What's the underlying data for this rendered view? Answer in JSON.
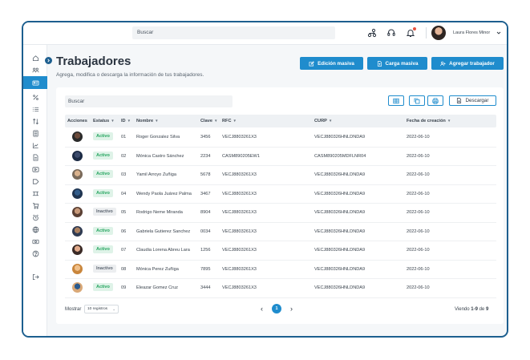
{
  "header": {
    "search_placeholder": "Buscar",
    "user_name": "Laura Flores Minor"
  },
  "page": {
    "title": "Trabajadores",
    "subtitle": "Agrega, modifica o descarga la información de tus trabajadores."
  },
  "actions": {
    "bulk_edit": "Edición masiva",
    "bulk_upload": "Carga masiva",
    "add_worker": "Agregar trabajador",
    "download": "Descargar"
  },
  "table": {
    "search_placeholder": "Buscar",
    "columns": [
      "Acciones",
      "Estatus",
      "ID",
      "Nombre",
      "Clave",
      "RFC",
      "CURP",
      "Fecha de creación"
    ],
    "rows": [
      {
        "status": "Activo",
        "id": "01",
        "name": "Roger Gonzalez Silva",
        "clave": "3456",
        "rfc": "VECJ8803261X3",
        "curp": "VECJ880326HNLDNDA9",
        "date": "2022-06-10"
      },
      {
        "status": "Activo",
        "id": "02",
        "name": "Mónica Castro Sánchez",
        "clave": "2234",
        "rfc": "CASM890205EW1",
        "curp": "CASM890205MDFLNR04",
        "date": "2022-06-10"
      },
      {
        "status": "Activo",
        "id": "03",
        "name": "Yamil Arroyo Zuñiga",
        "clave": "5678",
        "rfc": "VECJ8803261X3",
        "curp": "VECJ880326HNLDNDA9",
        "date": "2022-06-10"
      },
      {
        "status": "Activo",
        "id": "04",
        "name": "Wendy Paola Juárez Palma",
        "clave": "3467",
        "rfc": "VECJ8803261X3",
        "curp": "VECJ880326HNLDNDA9",
        "date": "2022-06-10"
      },
      {
        "status": "Inactivo",
        "id": "05",
        "name": "Rodrigo Neme Miranda",
        "clave": "8904",
        "rfc": "VECJ8803261X3",
        "curp": "VECJ880326HNLDNDA9",
        "date": "2022-06-10"
      },
      {
        "status": "Activo",
        "id": "06",
        "name": "Gabriela Gutierez Sanchez",
        "clave": "0034",
        "rfc": "VECJ8803261X3",
        "curp": "VECJ880326HNLDNDA9",
        "date": "2022-06-10"
      },
      {
        "status": "Activo",
        "id": "07",
        "name": "Claudia Lorena Abreu Lara",
        "clave": "1256",
        "rfc": "VECJ8803261X3",
        "curp": "VECJ880326HNLDNDA9",
        "date": "2022-06-10"
      },
      {
        "status": "Inactivo",
        "id": "08",
        "name": "Mónica Perez Zuñiga",
        "clave": "7895",
        "rfc": "VECJ8803261X3",
        "curp": "VECJ880326HNLDNDA9",
        "date": "2022-06-10"
      },
      {
        "status": "Activo",
        "id": "09",
        "name": "Eleazar Gomez Cruz",
        "clave": "3444",
        "rfc": "VECJ8803261X3",
        "curp": "VECJ880326HNLDNDA9",
        "date": "2022-06-10"
      }
    ]
  },
  "footer": {
    "show_label": "Mostrar",
    "page_size": "10 registros",
    "current_page": "1",
    "viewing_prefix": "Viendo",
    "viewing_range": "1-9",
    "viewing_of": "de",
    "viewing_total": "9"
  },
  "colors": {
    "primary": "#1f8ccd",
    "frame": "#1d5f8f",
    "active_text": "#25a55f",
    "active_bg": "#dff3e8",
    "inactive_bg": "#eceef0"
  }
}
